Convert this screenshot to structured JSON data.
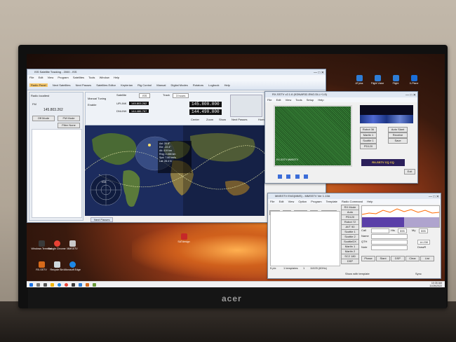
{
  "monitor": {
    "brand": "acer"
  },
  "main_window": {
    "title": "ISS Satellite Tracking - 2000 - ISS",
    "menu": [
      "File",
      "Edit",
      "View",
      "Program",
      "Satellites",
      "Tools",
      "Window",
      "Help"
    ],
    "ribbon": [
      "Radio Panel",
      "Next Satellites",
      "Next Passes",
      "Satellites Editor",
      "Keplerian",
      "Rig Control",
      "Manual",
      "Digital Modes",
      "Rotators",
      "Logbook",
      "Help"
    ],
    "radio_panel": {
      "title": "Radio localtest",
      "mode_label": "FM",
      "freq_value": "145.803.262",
      "labels": [
        "Off Mode",
        "FM Mode",
        "Filter None"
      ]
    },
    "tracking": {
      "satellite_label": "Satellite",
      "satellite_value": "ISS",
      "track_label": "Track",
      "track_value": "3 hours",
      "uplink_label": "UPLINK",
      "uplink_value": "145.803.262",
      "downlink_label": "DNLINK",
      "downlink_value": "144.486.767",
      "downlink_main": "145.800.000",
      "uplink_main": "144.490.000",
      "manual_tuning": "Manual Tuning",
      "enable": "Enable",
      "tabs": [
        "Center",
        "Zoom",
        "Show",
        "Next Passes",
        "Home Page"
      ]
    },
    "map": {
      "sat_name": "ISS",
      "info_lines": [
        "Azi: 20.8°",
        "Ele: -22.4°",
        "Alt: 419 km",
        "Rng: 2.466 km",
        "Spd: 7.66 km/s",
        "Lat: 28.4 N"
      ]
    },
    "bottom_tab": "Next Passes"
  },
  "sstv_window": {
    "title": "RX-SSTV v2.1.6 (KDNAR32-ENG.DLL+1.8)",
    "menu": [
      "File",
      "Edit",
      "View",
      "Tools",
      "Setup",
      "Help"
    ],
    "picture_caption": "RX-SSTV MMSSTV",
    "right_labels": [
      "Robot 36",
      "Martin 1",
      "Scottie 1",
      "PD120",
      "Auto Slant",
      "Receive",
      "Save"
    ],
    "logo_text": "RX-SSTV CQ CQ",
    "footer_button": "Exit"
  },
  "mmsstv_window": {
    "title": "MMSSTV ENG(MMS) - MMSSTV Ver 1.13A",
    "menu": [
      "File",
      "Edit",
      "View",
      "Option",
      "Program",
      "Template",
      "Radio Command",
      "Help"
    ],
    "tabs": [
      "Sync",
      "RX",
      "History",
      "TX",
      "Template"
    ],
    "modes": [
      "RX Mode",
      "Auto",
      "PD120",
      "Robot 72",
      "AVT 90",
      "Scottie 1",
      "Scottie 2",
      "ScottieDX",
      "Martin 1",
      "Martin 2",
      "SC2 180",
      "Pasokon",
      "AFC 130",
      "DSP"
    ],
    "log_labels": [
      "Call",
      "His",
      "My",
      "Name",
      "QTH",
      "Note",
      "QSL",
      "RST"
    ],
    "log_values": {
      "his": "595",
      "my": "595",
      "time": "14:230"
    },
    "bottom_buttons": [
      "Phase",
      "Slant",
      "DSP",
      "Clear",
      "List"
    ],
    "status": [
      "5 pix",
      "1 templates",
      "1",
      "11025 (60Hz)"
    ],
    "show_template": "Show with template",
    "sync_label": "Sync",
    "drawd": "DrawR"
  },
  "desktop_icons": [
    {
      "label": "Windows Terminal",
      "color": "#3a3a3a"
    },
    {
      "label": "Google Chrome",
      "color": "#e94235"
    },
    {
      "label": "MMSSTV",
      "color": "#c8c8c8"
    },
    {
      "label": "Microsoft Edge",
      "color": "#1e88e5"
    },
    {
      "label": "RX-SSTV",
      "color": "#d86a1a"
    },
    {
      "label": "Recycle Bin",
      "color": "#cfd8dc"
    },
    {
      "label": "SATdesign",
      "color": "#c62828"
    }
  ],
  "top_right_icons": [
    {
      "label": "ATplus",
      "color": "#2e7dd6"
    },
    {
      "label": "Flight Voice",
      "color": "#2e7dd6"
    },
    {
      "label": "Flight",
      "color": "#2e7dd6"
    },
    {
      "label": "X-Plane",
      "color": "#1a6ed8"
    }
  ],
  "taskbar": {
    "time": "10:35 AM",
    "date": "11/26/2022"
  }
}
